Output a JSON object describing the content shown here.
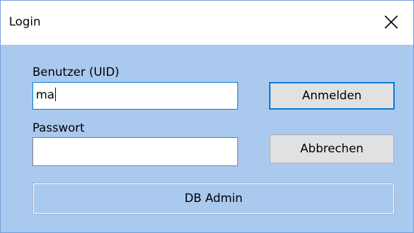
{
  "window": {
    "title": "Login",
    "close_icon": "close-icon"
  },
  "form": {
    "user_label": "Benutzer (UID)",
    "user_value": "ma",
    "password_label": "Passwort",
    "password_value": ""
  },
  "buttons": {
    "login": "Anmelden",
    "cancel": "Abbrechen",
    "db_admin": "DB Admin"
  },
  "colors": {
    "dialog_background": "#aac9ef",
    "focus_accent": "#0078d7",
    "button_face": "#e1e1e1"
  }
}
